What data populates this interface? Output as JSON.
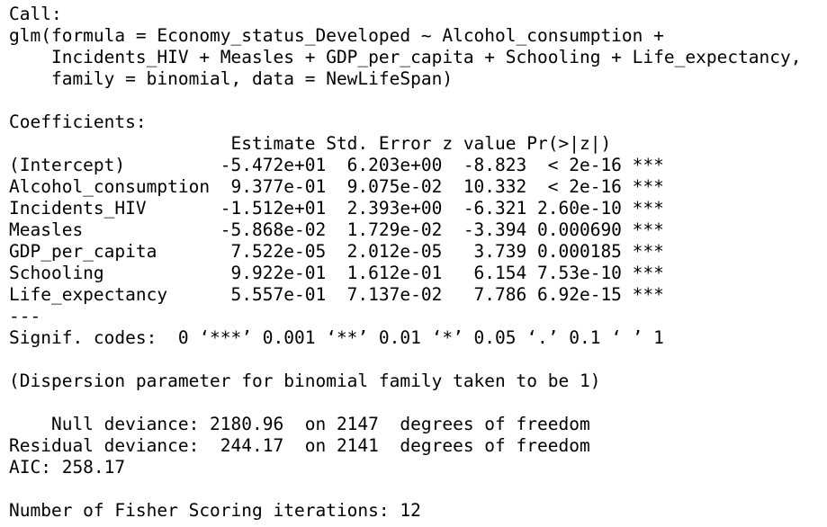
{
  "output": {
    "call_header": "Call:",
    "call_line1": "glm(formula = Economy_status_Developed ~ Alcohol_consumption +",
    "call_line2": "    Incidents_HIV + Measles + GDP_per_capita + Schooling + Life_expectancy,",
    "call_line3": "    family = binomial, data = NewLifeSpan)",
    "coef_header": "Coefficients:",
    "coef_columns": "                     Estimate Std. Error z value Pr(>|z|)    ",
    "coef_rows": [
      "(Intercept)         -5.472e+01  6.203e+00  -8.823  < 2e-16 ***",
      "Alcohol_consumption  9.377e-01  9.075e-02  10.332  < 2e-16 ***",
      "Incidents_HIV       -1.512e+01  2.393e+00  -6.321 2.60e-10 ***",
      "Measles             -5.868e-02  1.729e-02  -3.394 0.000690 ***",
      "GDP_per_capita       7.522e-05  2.012e-05   3.739 0.000185 ***",
      "Schooling            9.922e-01  1.612e-01   6.154 7.53e-10 ***",
      "Life_expectancy      5.557e-01  7.137e-02   7.786 6.92e-15 ***"
    ],
    "separator": "---",
    "signif_codes": "Signif. codes:  0 ‘***’ 0.001 ‘**’ 0.01 ‘*’ 0.05 ‘.’ 0.1 ‘ ’ 1",
    "dispersion": "(Dispersion parameter for binomial family taken to be 1)",
    "null_deviance": "    Null deviance: 2180.96  on 2147  degrees of freedom",
    "residual_deviance": "Residual deviance:  244.17  on 2141  degrees of freedom",
    "aic": "AIC: 258.17",
    "fisher": "Number of Fisher Scoring iterations: 12"
  }
}
